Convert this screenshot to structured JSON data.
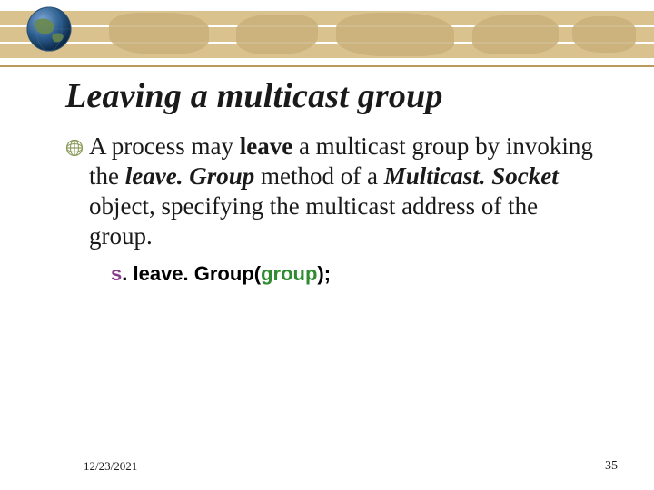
{
  "title": "Leaving a multicast group",
  "body": {
    "t1": "A process may ",
    "t2": "leave",
    "t3": " a multicast group by invoking the ",
    "t4": "leave. Group",
    "t5": " method of a ",
    "t6": "Multicast. Socket",
    "t7": " object, specifying the multicast address of the group."
  },
  "code": {
    "s": "s",
    "dot1": ". ",
    "method": "leave. Group(",
    "arg": "group",
    "close": ");"
  },
  "footer": {
    "date": "12/23/2021",
    "page": "35"
  }
}
